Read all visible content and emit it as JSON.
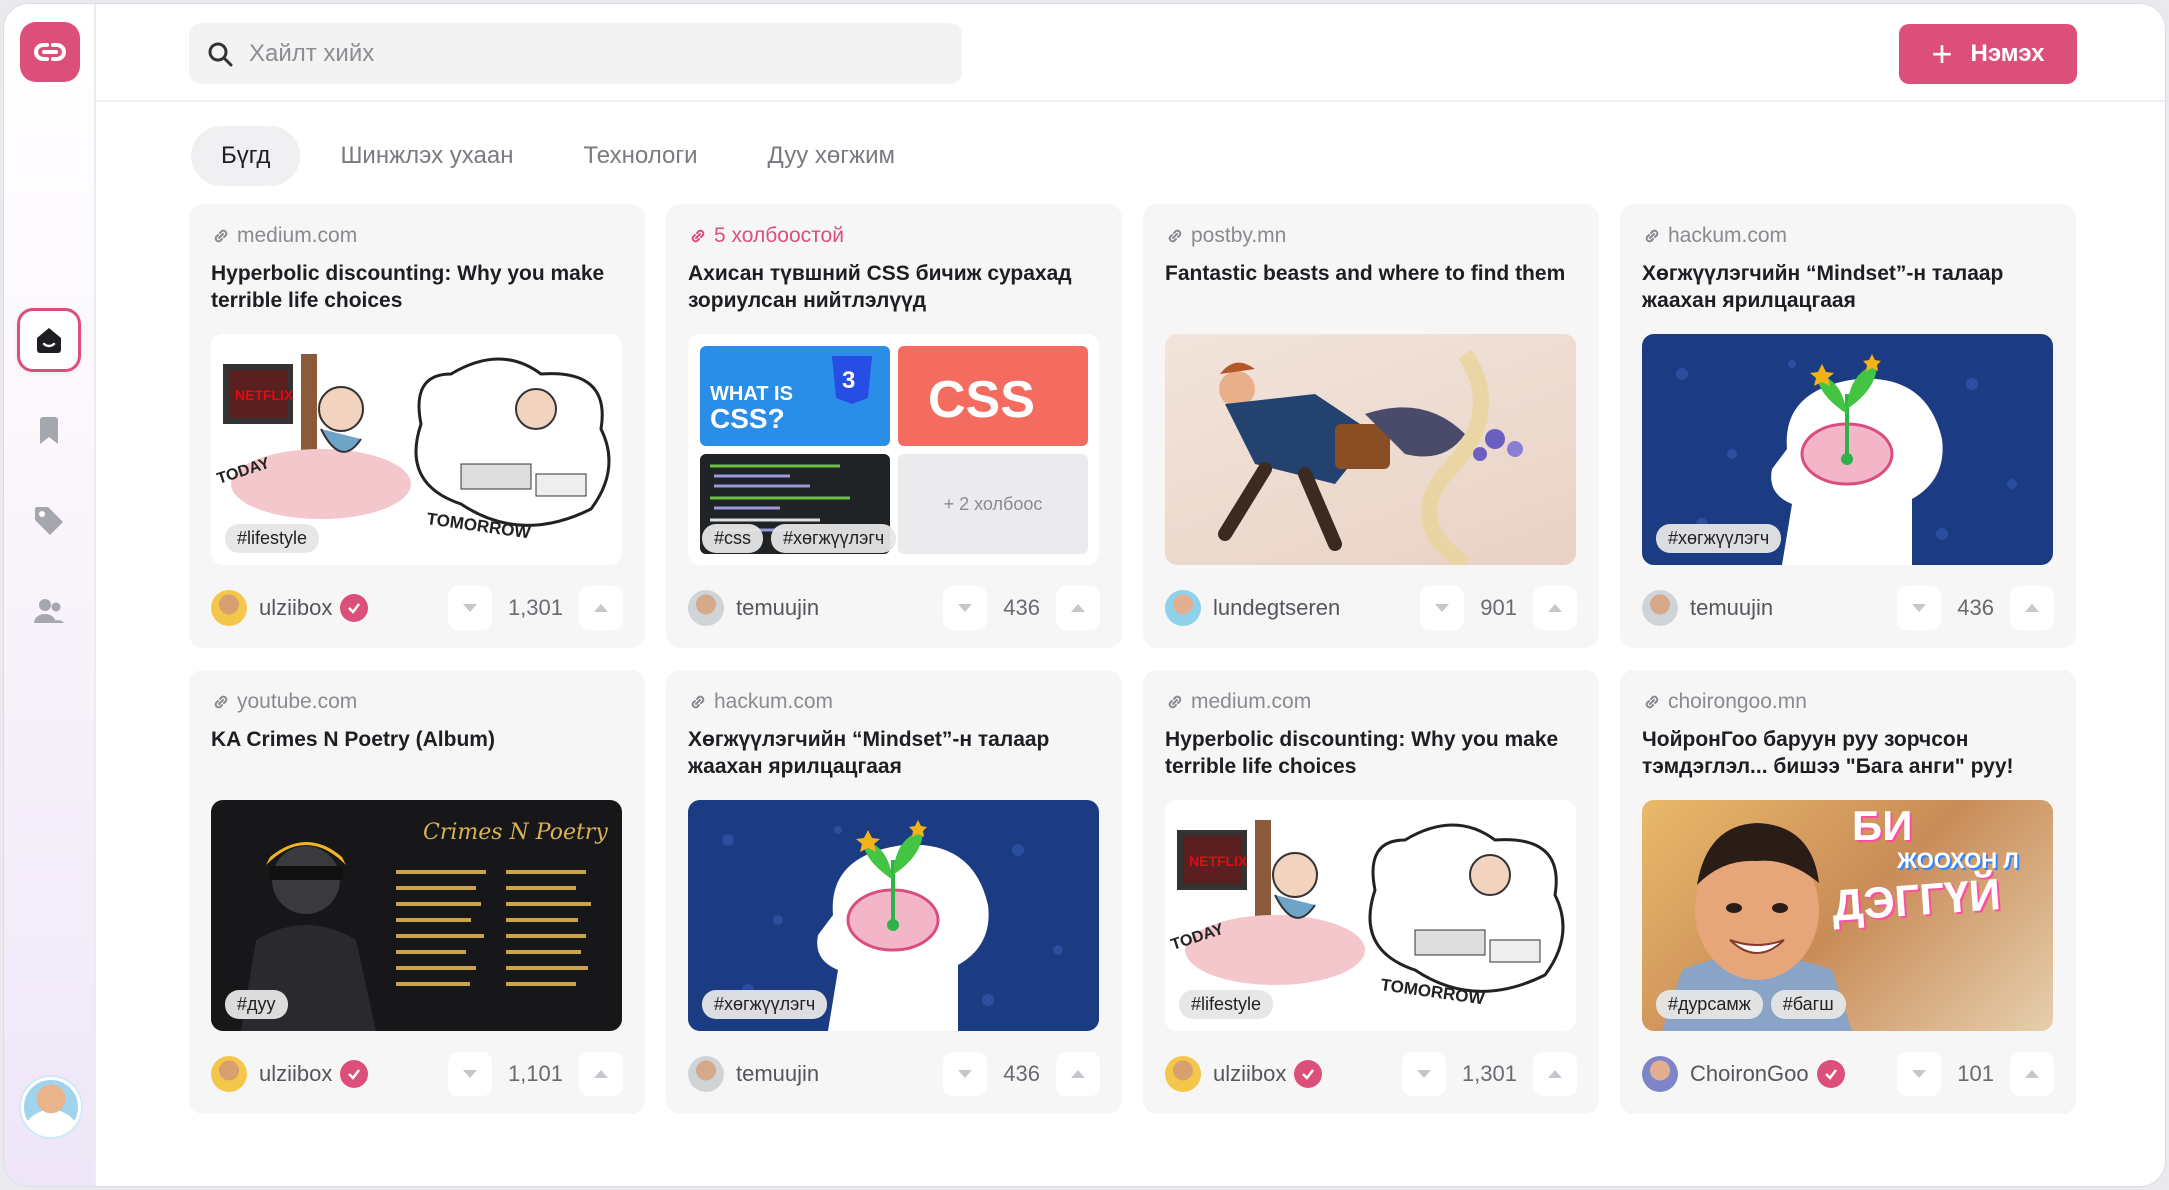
{
  "search": {
    "placeholder": "Хайлт хийх"
  },
  "header": {
    "add_label": "Нэмэх"
  },
  "tabs": [
    "Бүгд",
    "Шинжлэх ухаан",
    "Технологи",
    "Дуу хөгжим"
  ],
  "colors": {
    "accent": "#dc4f7b",
    "card_bg": "#f6f6f7"
  },
  "icons": {
    "logo": "link-icon",
    "nav": [
      "home-icon",
      "bookmark-icon",
      "tag-icon",
      "users-icon"
    ],
    "search": "search-icon",
    "vote_down": "chevron-down-icon",
    "vote_up": "chevron-up-icon",
    "verified": "verified-check-icon"
  },
  "cards": [
    {
      "source": "medium.com",
      "title": "Hyperbolic discounting: Why you make terrible life choices",
      "tags": [
        "#lifestyle"
      ],
      "user": "ulziibox",
      "verified": true,
      "votes": "1,301"
    },
    {
      "source": "5 холбоостой",
      "title": "Ахисан түвшний CSS бичиж сурахад зориулсан нийтлэлүүд",
      "tags": [
        "#css",
        "#хөгжүүлэгч"
      ],
      "more_links": "+ 2 холбоос",
      "thumb_text": [
        "WHAT IS",
        "CSS?",
        "CSS"
      ],
      "user": "temuujin",
      "verified": false,
      "votes": "436"
    },
    {
      "source": "postby.mn",
      "title": "Fantastic beasts and where to find them",
      "tags": [],
      "user": "lundegtseren",
      "verified": false,
      "votes": "901"
    },
    {
      "source": "hackum.com",
      "title": "Хөгжүүлэгчийн “Mindset”-н талаар жаахан ярилцацгаая",
      "tags": [
        "#хөгжүүлэгч"
      ],
      "user": "temuujin",
      "verified": false,
      "votes": "436"
    },
    {
      "source": "youtube.com",
      "title": "KA Crimes N Poetry (Album)",
      "tags": [
        "#дуу"
      ],
      "thumb_text": [
        "Crimes N Poetry"
      ],
      "user": "ulziibox",
      "verified": true,
      "votes": "1,101"
    },
    {
      "source": "hackum.com",
      "title": "Хөгжүүлэгчийн “Mindset”-н талаар жаахан ярилцацгаая",
      "tags": [
        "#хөгжүүлэгч"
      ],
      "user": "temuujin",
      "verified": false,
      "votes": "436"
    },
    {
      "source": "medium.com",
      "title": "Hyperbolic discounting: Why you make terrible life choices",
      "tags": [
        "#lifestyle"
      ],
      "user": "ulziibox",
      "verified": true,
      "votes": "1,301"
    },
    {
      "source": "choirongoo.mn",
      "title": "ЧойронГоо баруун руу зорчсон тэмдэглэл... бишээ \"Бага анги\" руу!",
      "tags": [
        "#дурсамж",
        "#багш"
      ],
      "thumb_text": [
        "БИ",
        "ЖООХОН Л",
        "ДЭГГҮЙ"
      ],
      "user": "ChoironGoo",
      "verified": true,
      "votes": "101"
    }
  ]
}
